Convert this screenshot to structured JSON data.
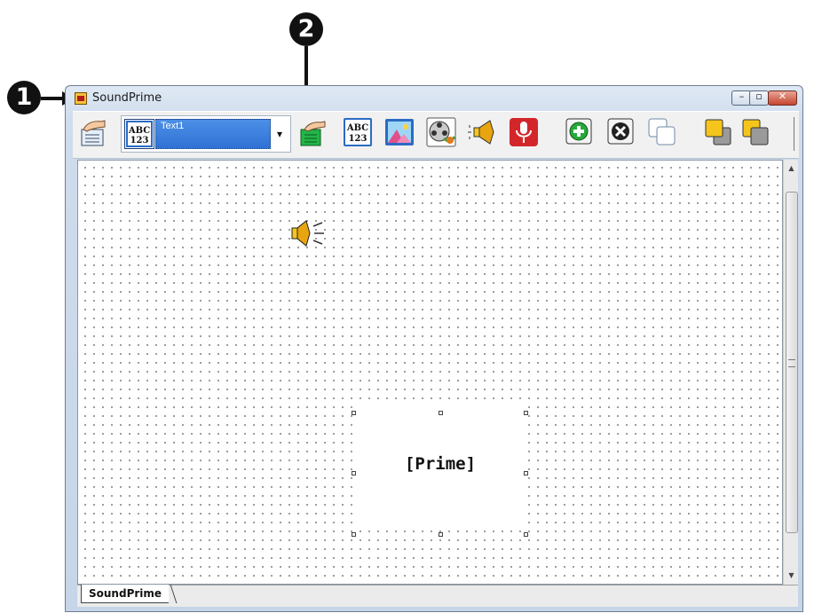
{
  "callouts": {
    "one": "1",
    "two": "2"
  },
  "window": {
    "title": "SoundPrime",
    "minimize": "–",
    "maximize": "▫",
    "close": "✕"
  },
  "toolbar": {
    "combo_value": "Text1",
    "tools": [
      "pointer-tool",
      "text-object-tool",
      "text-tool",
      "picture-tool",
      "movie-tool",
      "sound-tool",
      "record-tool",
      "add-tool",
      "delete-tool",
      "copy-tool",
      "bring-forward-tool",
      "send-backward-tool"
    ]
  },
  "canvas": {
    "prime_text": "[Prime]"
  },
  "tabs": {
    "active": "SoundPrime"
  },
  "colors": {
    "selection": "#2f72d6",
    "close_button": "#c5452f"
  }
}
